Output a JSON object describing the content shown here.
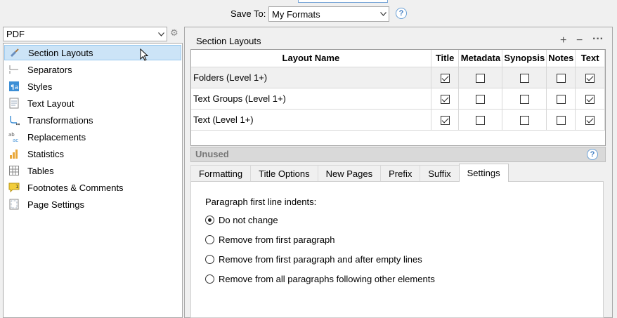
{
  "save_to": {
    "label": "Save To:",
    "value": "My Formats"
  },
  "format_select": {
    "value": "PDF"
  },
  "nav_items": [
    {
      "label": "Section Layouts",
      "icon": "brush-icon",
      "selected": true
    },
    {
      "label": "Separators",
      "icon": "separator-icon"
    },
    {
      "label": "Styles",
      "icon": "styles-icon"
    },
    {
      "label": "Text Layout",
      "icon": "text-layout-icon"
    },
    {
      "label": "Transformations",
      "icon": "transformations-icon"
    },
    {
      "label": "Replacements",
      "icon": "replacements-icon"
    },
    {
      "label": "Statistics",
      "icon": "statistics-icon"
    },
    {
      "label": "Tables",
      "icon": "tables-icon"
    },
    {
      "label": "Footnotes & Comments",
      "icon": "footnote-icon"
    },
    {
      "label": "Page Settings",
      "icon": "page-settings-icon"
    }
  ],
  "section_layouts": {
    "title": "Section Layouts",
    "columns": [
      "Layout Name",
      "Title",
      "Metadata",
      "Synopsis",
      "Notes",
      "Text"
    ],
    "rows": [
      {
        "name": "Folders (Level 1+)",
        "checks": [
          true,
          false,
          false,
          false,
          true
        ]
      },
      {
        "name": "Text Groups (Level 1+)",
        "checks": [
          true,
          false,
          false,
          false,
          true
        ]
      },
      {
        "name": "Text (Level 1+)",
        "checks": [
          true,
          false,
          false,
          false,
          true
        ]
      }
    ]
  },
  "unused_label": "Unused",
  "tabs": [
    "Formatting",
    "Title Options",
    "New Pages",
    "Prefix",
    "Suffix",
    "Settings"
  ],
  "active_tab": "Settings",
  "settings": {
    "para_label": "Paragraph first line indents:",
    "options": [
      {
        "label": "Do not change",
        "selected": true
      },
      {
        "label": "Remove from first paragraph",
        "selected": false
      },
      {
        "label": "Remove from first paragraph and after empty lines",
        "selected": false
      },
      {
        "label": "Remove from all paragraphs following other elements",
        "selected": false
      }
    ]
  },
  "colors": {
    "selection": "#cce4f7",
    "selection_border": "#99c9ef",
    "accent": "#3e7cc2"
  }
}
